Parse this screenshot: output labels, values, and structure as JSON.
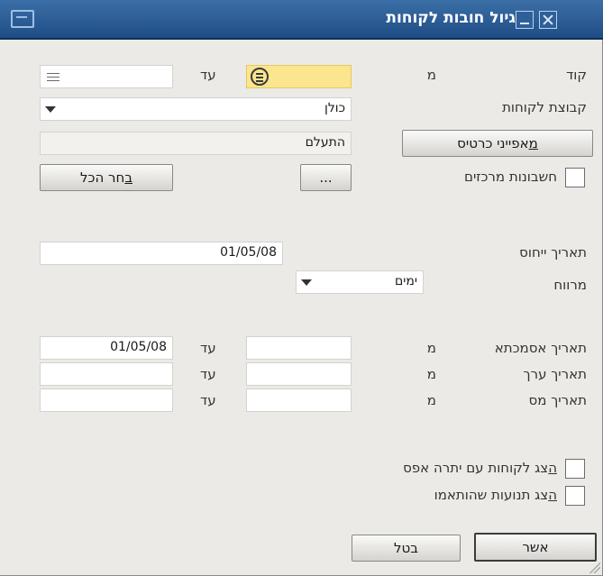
{
  "window": {
    "title": "גיול חובות לקוחות"
  },
  "code": {
    "label": "קוד",
    "from_label": "מ",
    "to_label": "עד",
    "from_value": "",
    "to_value": ""
  },
  "customer_group": {
    "label": "קבוצת לקוחות",
    "value": "כולן"
  },
  "properties": {
    "button_label_mn": "מ",
    "button_label_rest": "אפייני כרטיס",
    "value": "התעלם"
  },
  "central_accounts": {
    "label": "חשבונות מרכזים",
    "checked": false,
    "ellipsis": "...",
    "select_all_label_mn": "ב",
    "select_all_label_rest": "חר הכל"
  },
  "reference_date": {
    "label": "תאריך ייחוס",
    "value": "01/05/08"
  },
  "interval": {
    "label": "מרווח",
    "value": "ימים"
  },
  "date_rows": [
    {
      "label": "תאריך אסמכתא",
      "from_label": "מ",
      "to_label": "עד",
      "from_value": "",
      "to_value": "01/05/08"
    },
    {
      "label": "תאריך ערך",
      "from_label": "מ",
      "to_label": "עד",
      "from_value": "",
      "to_value": ""
    },
    {
      "label": "תאריך מס",
      "from_label": "מ",
      "to_label": "עד",
      "from_value": "",
      "to_value": ""
    }
  ],
  "options": [
    {
      "label_mn": "ה",
      "label_rest": "צג לקוחות עם יתרה אפס",
      "checked": false
    },
    {
      "label_mn": "ה",
      "label_rest": "צג תנועות שהותאמו",
      "checked": false
    }
  ],
  "buttons": {
    "ok": "אשר",
    "cancel": "בטל"
  },
  "colors": {
    "title_bar": "#1f4d86",
    "window_bg": "#eceae6",
    "highlight_field": "#fbe58e"
  },
  "icons": [
    "app-window-icon",
    "minimize-icon",
    "close-icon",
    "lookup-icon",
    "list-icon",
    "dropdown-arrow-icon"
  ]
}
